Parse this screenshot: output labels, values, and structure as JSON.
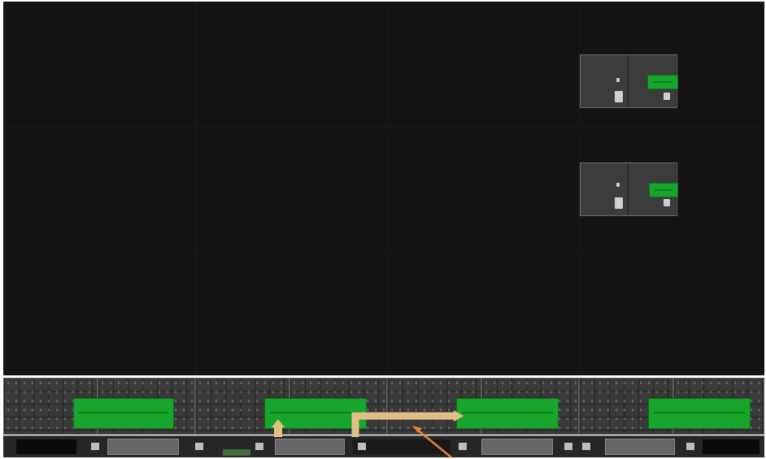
{
  "scene": {
    "description_visible_text": "",
    "colors": {
      "wall": "#141414",
      "cabinet": "#3a3a3a",
      "pcb_green": "#17a52c",
      "cable_tan": "#e2bf84",
      "arrow_orange": "#e8823a"
    },
    "top_modules_count": 2,
    "bottom_cabinets_count": 8,
    "icons": [
      "cable-connector-icon",
      "pointer-arrow-icon"
    ]
  }
}
